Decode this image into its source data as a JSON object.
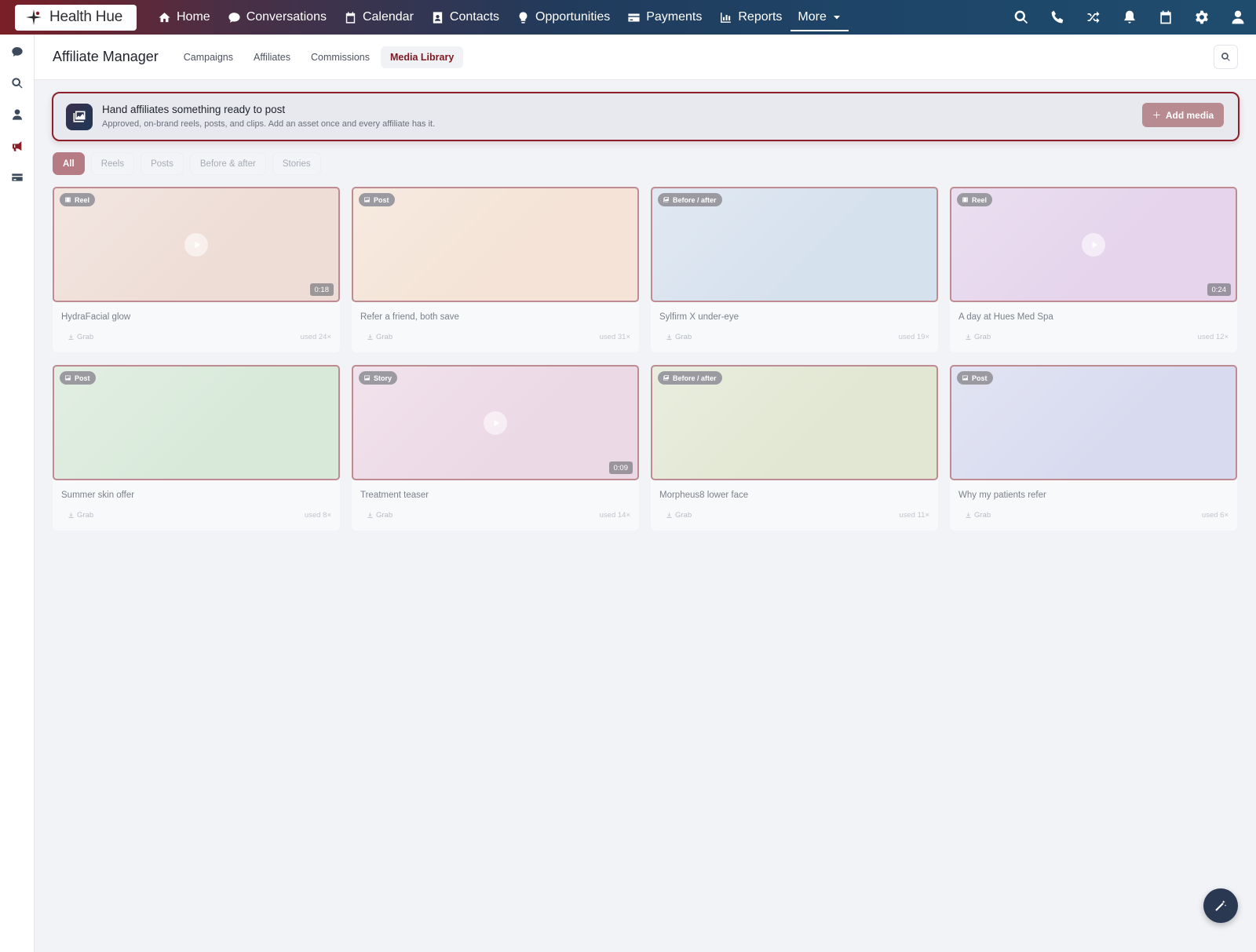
{
  "brand": {
    "name": "Health Hue"
  },
  "topnav": {
    "items": [
      {
        "label": "Home",
        "icon": "home-icon"
      },
      {
        "label": "Conversations",
        "icon": "chat-icon"
      },
      {
        "label": "Calendar",
        "icon": "calendar-icon"
      },
      {
        "label": "Contacts",
        "icon": "contact-card-icon"
      },
      {
        "label": "Opportunities",
        "icon": "lightbulb-icon"
      },
      {
        "label": "Payments",
        "icon": "credit-card-icon"
      },
      {
        "label": "Reports",
        "icon": "bar-chart-icon"
      }
    ],
    "more_label": "More",
    "right_icons": [
      "search-icon",
      "phone-icon",
      "shuffle-icon",
      "bell-icon",
      "calendar-icon",
      "gear-icon",
      "user-icon"
    ]
  },
  "rail": {
    "icons": [
      "chat-icon",
      "search-icon",
      "user-icon",
      "megaphone-icon",
      "card-icon"
    ],
    "active": "megaphone-icon"
  },
  "subheader": {
    "title": "Affiliate Manager",
    "tabs": [
      "Campaigns",
      "Affiliates",
      "Commissions",
      "Media Library"
    ],
    "active_tab": "Media Library"
  },
  "banner": {
    "title": "Hand affiliates something ready to post",
    "subtitle": "Approved, on-brand reels, posts, and clips. Add an asset once and every affiliate has it.",
    "button_label": "Add media",
    "button_icon": "plus-icon"
  },
  "filters": {
    "chips": [
      "All",
      "Reels",
      "Posts",
      "Before & after",
      "Stories"
    ],
    "active": "All"
  },
  "grab_label": "Grab",
  "cards": [
    {
      "badge": "Reel",
      "title": "HydraFacial glow",
      "duration": "0:18",
      "used": "used 24×",
      "video": true,
      "bg": "#eeddd6"
    },
    {
      "badge": "Post",
      "title": "Refer a friend, both save",
      "duration": "",
      "used": "used 31×",
      "video": false,
      "bg": "#f4e3d6"
    },
    {
      "badge": "Before / after",
      "title": "Sylfirm X under-eye",
      "duration": "",
      "used": "used 19×",
      "video": false,
      "bg": "#d6e1ee"
    },
    {
      "badge": "Reel",
      "title": "A day at Hues Med Spa",
      "duration": "0:24",
      "used": "used 12×",
      "video": true,
      "bg": "#e5d4ec"
    },
    {
      "badge": "Post",
      "title": "Summer skin offer",
      "duration": "",
      "used": "used 8×",
      "video": false,
      "bg": "#d8e9d9"
    },
    {
      "badge": "Story",
      "title": "Treatment teaser",
      "duration": "0:09",
      "used": "used 14×",
      "video": true,
      "bg": "#ecd9e6"
    },
    {
      "badge": "Before / after",
      "title": "Morpheus8 lower face",
      "duration": "",
      "used": "used 11×",
      "video": false,
      "bg": "#e2e7d3"
    },
    {
      "badge": "Post",
      "title": "Why my patients refer",
      "duration": "",
      "used": "used 6×",
      "video": false,
      "bg": "#d8dbef"
    }
  ]
}
